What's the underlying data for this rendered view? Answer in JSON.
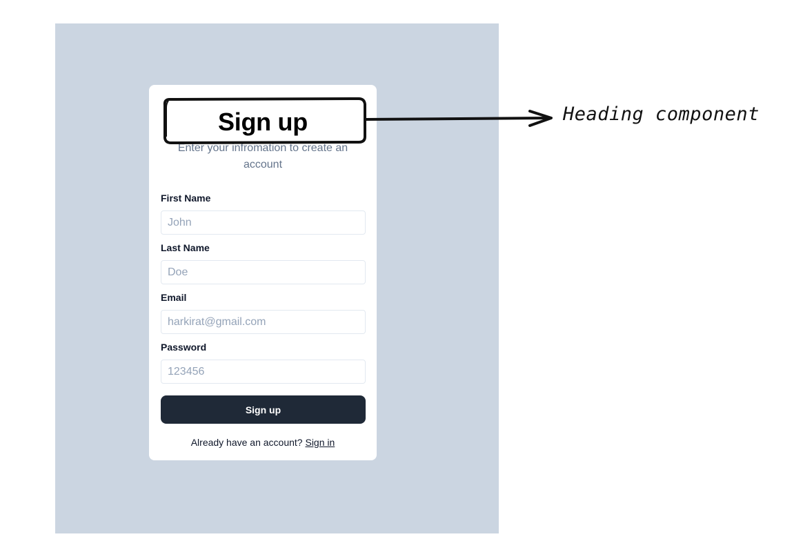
{
  "signup_card": {
    "heading": "Sign up",
    "subheading": "Enter your infromation to create an account",
    "fields": [
      {
        "label": "First Name",
        "placeholder": "John"
      },
      {
        "label": "Last Name",
        "placeholder": "Doe"
      },
      {
        "label": "Email",
        "placeholder": "harkirat@gmail.com"
      },
      {
        "label": "Password",
        "placeholder": "123456"
      }
    ],
    "submit_label": "Sign up",
    "footer_text": "Already have an account?",
    "footer_link": "Sign in"
  },
  "annotation": {
    "label": "Heading component"
  },
  "colors": {
    "backdrop": "#cbd5e1",
    "button": "#1f2937",
    "subtle_text": "#64748b"
  }
}
